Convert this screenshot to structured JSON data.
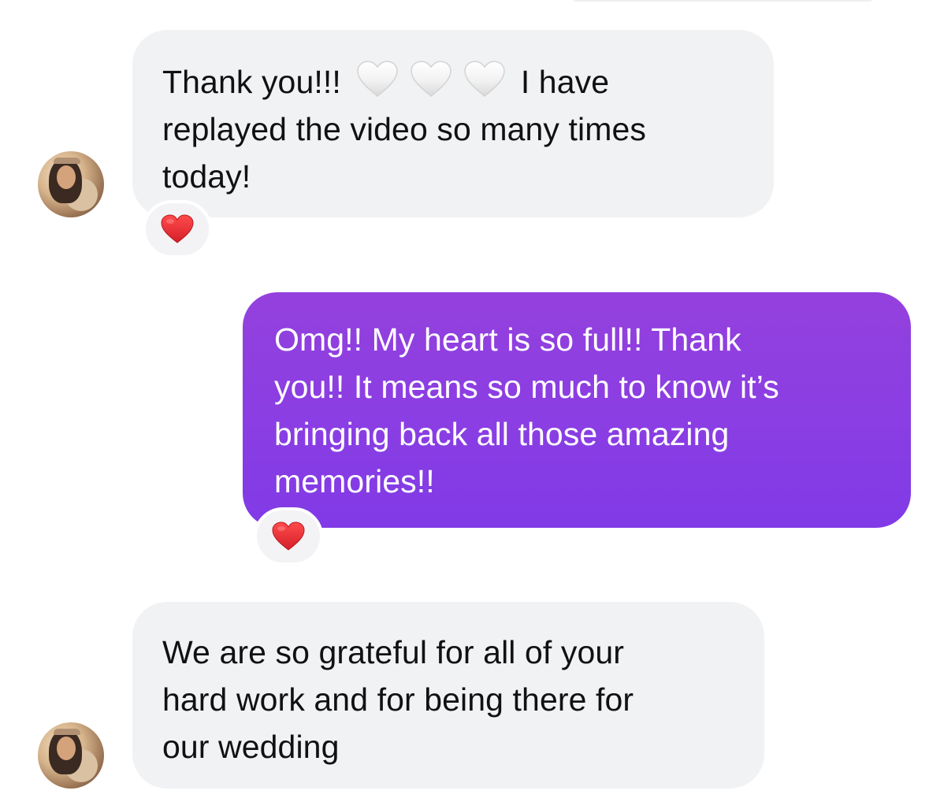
{
  "messages": [
    {
      "direction": "incoming",
      "text_before_emoji": "Thank you!!!",
      "inline_emoji": [
        "white-heart",
        "white-heart",
        "white-heart"
      ],
      "lines": [
        "I have",
        "replayed the video so many times",
        "today!"
      ],
      "reaction": "red-heart"
    },
    {
      "direction": "outgoing",
      "lines": [
        "Omg!! My heart is so full!! Thank",
        "you!! It means so much to know it’s",
        "bringing back all those amazing",
        "memories!!"
      ],
      "reaction": "red-heart"
    },
    {
      "direction": "incoming",
      "lines": [
        "We are so grateful for all of your",
        "hard work and for being there for",
        "our wedding"
      ]
    }
  ],
  "colors": {
    "incoming_bubble": "#f1f2f4",
    "outgoing_bubble": "#8a3ee3",
    "outgoing_text": "#ffffff",
    "incoming_text": "#111111",
    "reaction_heart": "#e0242b"
  }
}
